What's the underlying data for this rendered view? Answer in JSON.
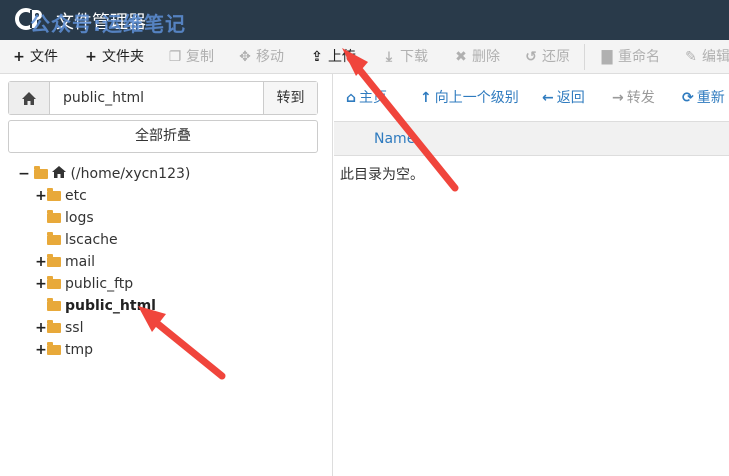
{
  "header": {
    "app_title": "文件管理器",
    "watermark": "公众号:运维笔记",
    "bg_color": "#293a4a"
  },
  "toolbar": {
    "buttons": [
      {
        "icon": "plus-icon",
        "label": "文件",
        "enabled": true
      },
      {
        "icon": "plus-icon",
        "label": "文件夹",
        "enabled": true
      },
      {
        "icon": "copy-icon",
        "label": "复制",
        "enabled": false
      },
      {
        "icon": "move-icon",
        "label": "移动",
        "enabled": false
      },
      {
        "icon": "upload-icon",
        "label": "上传",
        "enabled": true
      },
      {
        "icon": "download-icon",
        "label": "下载",
        "enabled": false
      },
      {
        "icon": "delete-icon",
        "label": "删除",
        "enabled": false
      },
      {
        "icon": "restore-icon",
        "label": "还原",
        "enabled": false
      },
      {
        "icon": "rename-icon",
        "label": "重命名",
        "enabled": false
      },
      {
        "icon": "edit-icon",
        "label": "编辑",
        "enabled": false
      }
    ]
  },
  "left_panel": {
    "path_value": "public_html",
    "go_label": "转到",
    "collapse_label": "全部折叠",
    "tree": {
      "root_label": "(/home/xycn123)",
      "items": [
        {
          "label": "etc",
          "expandable": true,
          "active": false
        },
        {
          "label": "logs",
          "expandable": false,
          "active": false
        },
        {
          "label": "lscache",
          "expandable": false,
          "active": false
        },
        {
          "label": "mail",
          "expandable": true,
          "active": false
        },
        {
          "label": "public_ftp",
          "expandable": true,
          "active": false
        },
        {
          "label": "public_html",
          "expandable": false,
          "active": true
        },
        {
          "label": "ssl",
          "expandable": true,
          "active": false
        },
        {
          "label": "tmp",
          "expandable": true,
          "active": false
        }
      ]
    }
  },
  "right_panel": {
    "nav": [
      {
        "icon": "home-icon",
        "label": "主页",
        "enabled": true
      },
      {
        "icon": "up-level-icon",
        "label": "向上一个级别",
        "enabled": true
      },
      {
        "icon": "back-icon",
        "label": "返回",
        "enabled": true
      },
      {
        "icon": "forward-icon",
        "label": "转发",
        "enabled": false
      },
      {
        "icon": "reload-icon",
        "label": "重新",
        "enabled": true
      }
    ],
    "column_name": "Name",
    "empty_message": "此目录为空。"
  },
  "colors": {
    "link": "#2f7bbf",
    "folder": "#e8a93a",
    "arrow": "#f0453c"
  }
}
